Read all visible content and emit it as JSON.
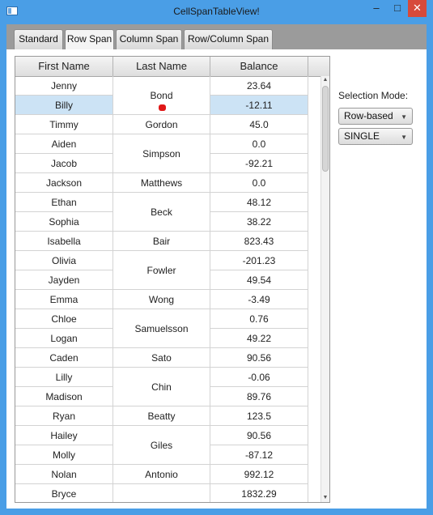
{
  "window": {
    "title": "CellSpanTableView!",
    "minimize_glyph": "–",
    "maximize_glyph": "□",
    "close_glyph": "✕"
  },
  "tabs": [
    {
      "label": "Standard",
      "active": false
    },
    {
      "label": "Row Span",
      "active": true
    },
    {
      "label": "Column Span",
      "active": false
    },
    {
      "label": "Row/Column Span",
      "active": false
    }
  ],
  "table": {
    "columns": [
      "First Name",
      "Last Name",
      "Balance"
    ],
    "rows": [
      {
        "first": "Jenny",
        "balance": "23.64"
      },
      {
        "first": "Billy",
        "balance": "-12.11",
        "selected": true
      },
      {
        "first": "Timmy",
        "balance": "45.0"
      },
      {
        "first": "Aiden",
        "balance": "0.0"
      },
      {
        "first": "Jacob",
        "balance": "-92.21"
      },
      {
        "first": "Jackson",
        "balance": "0.0"
      },
      {
        "first": "Ethan",
        "balance": "48.12"
      },
      {
        "first": "Sophia",
        "balance": "38.22"
      },
      {
        "first": "Isabella",
        "balance": "823.43"
      },
      {
        "first": "Olivia",
        "balance": "-201.23"
      },
      {
        "first": "Jayden",
        "balance": "49.54"
      },
      {
        "first": "Emma",
        "balance": "-3.49"
      },
      {
        "first": "Chloe",
        "balance": "0.76"
      },
      {
        "first": "Logan",
        "balance": "49.22"
      },
      {
        "first": "Caden",
        "balance": "90.56"
      },
      {
        "first": "Lilly",
        "balance": "-0.06"
      },
      {
        "first": "Madison",
        "balance": "89.76"
      },
      {
        "first": "Ryan",
        "balance": "123.5"
      },
      {
        "first": "Hailey",
        "balance": "90.56"
      },
      {
        "first": "Molly",
        "balance": "-87.12"
      },
      {
        "first": "Nolan",
        "balance": "992.12"
      },
      {
        "first": "Bryce",
        "balance": "1832.29"
      }
    ],
    "last_name_spans": [
      {
        "name": "Bond",
        "start": 0,
        "span": 2
      },
      {
        "name": "Gordon",
        "start": 2,
        "span": 1
      },
      {
        "name": "Simpson",
        "start": 3,
        "span": 2
      },
      {
        "name": "Matthews",
        "start": 5,
        "span": 1
      },
      {
        "name": "Beck",
        "start": 6,
        "span": 2
      },
      {
        "name": "Bair",
        "start": 8,
        "span": 1
      },
      {
        "name": "Fowler",
        "start": 9,
        "span": 2
      },
      {
        "name": "Wong",
        "start": 11,
        "span": 1
      },
      {
        "name": "Samuelsson",
        "start": 12,
        "span": 2
      },
      {
        "name": "Sato",
        "start": 14,
        "span": 1
      },
      {
        "name": "Chin",
        "start": 15,
        "span": 2
      },
      {
        "name": "Beatty",
        "start": 17,
        "span": 1
      },
      {
        "name": "Giles",
        "start": 18,
        "span": 2
      },
      {
        "name": "Antonio",
        "start": 20,
        "span": 1
      },
      {
        "name": "",
        "start": 21,
        "span": 1
      }
    ]
  },
  "selection_mode": {
    "label": "Selection Mode:",
    "mode_value": "Row-based",
    "type_value": "SINGLE"
  },
  "colors": {
    "selection": "#cce3f5",
    "titlebar": "#4a9ee6",
    "close": "#d74a3b",
    "marker": "#e01818"
  }
}
